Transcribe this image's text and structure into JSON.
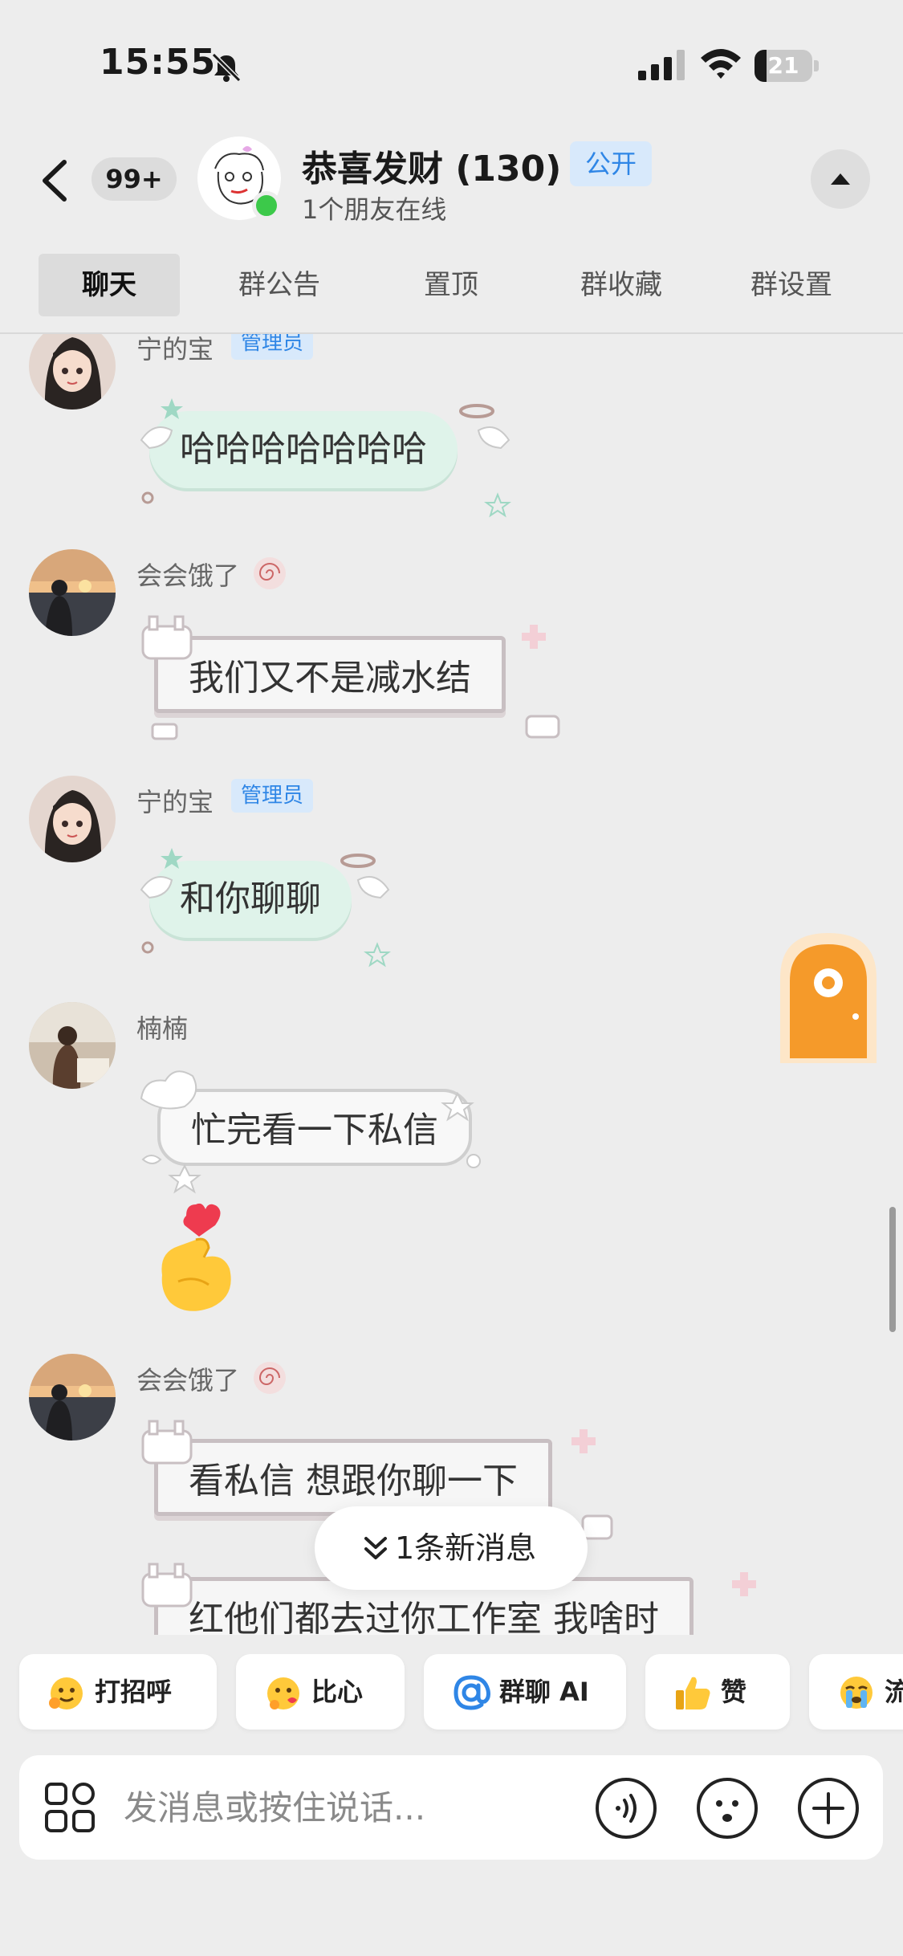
{
  "status_bar": {
    "time": "15:55",
    "battery_level": "21",
    "battery_fraction": 0.21,
    "icons": [
      "bell-slash-icon",
      "signal-icon",
      "wifi-icon",
      "battery-icon"
    ]
  },
  "header": {
    "unread_count": "99+",
    "group_name": "恭喜发财 (130)",
    "public_label": "公开",
    "online_status": "1个朋友在线"
  },
  "tabs": [
    {
      "label": "聊天",
      "active": true
    },
    {
      "label": "群公告",
      "active": false
    },
    {
      "label": "置顶",
      "active": false
    },
    {
      "label": "群收藏",
      "active": false
    },
    {
      "label": "群设置",
      "active": false
    }
  ],
  "messages": [
    {
      "sender": "宁的宝",
      "badge": "管理员",
      "text": "哈哈哈哈哈哈哈",
      "bubble": "angel"
    },
    {
      "sender": "会会饿了",
      "text": "我们又不是减水结",
      "bubble": "pixel"
    },
    {
      "sender": "宁的宝",
      "badge": "管理员",
      "text": "和你聊聊",
      "bubble": "angel"
    },
    {
      "sender": "楠楠",
      "text": "忙完看一下私信",
      "bubble": "cloud",
      "sticker": "finger-heart-emoji"
    },
    {
      "sender": "会会饿了",
      "texts": [
        "看私信 想跟你聊一下",
        "红他们都去过你工作室 我啥时"
      ],
      "bubble": "pixel"
    }
  ],
  "new_messages": {
    "label": "1条新消息"
  },
  "quick_replies": [
    {
      "label": "打招呼",
      "icon": "wave-face-icon"
    },
    {
      "label": "比心",
      "icon": "heart-hands-face-icon"
    },
    {
      "label": "群聊 AI",
      "icon": "at-sign-icon"
    },
    {
      "label": "赞",
      "icon": "thumbs-up-icon"
    },
    {
      "label": "流",
      "icon": "crying-face-icon"
    }
  ],
  "input": {
    "placeholder": "发消息或按住说话..."
  },
  "colors": {
    "background": "#ededed",
    "accent_blue": "#2f86e6",
    "online_green": "#3cc94a",
    "angel_bubble": "#dff3ea",
    "pixel_bubble_border": "#c8bfc2"
  }
}
